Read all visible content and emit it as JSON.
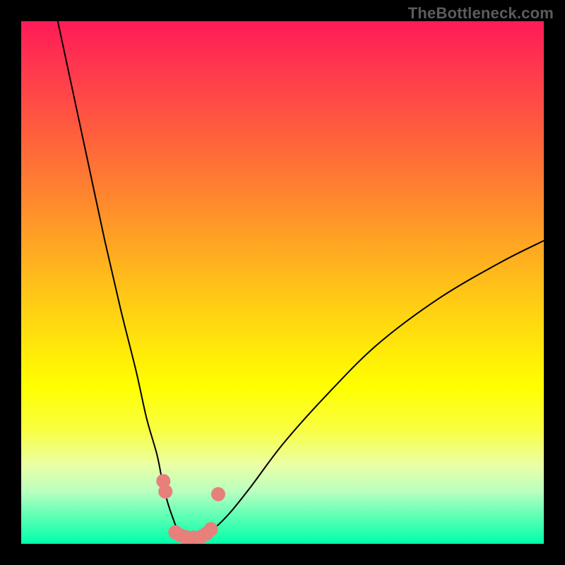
{
  "attribution": "TheBottleneck.com",
  "chart_data": {
    "type": "line",
    "title": "",
    "xlabel": "",
    "ylabel": "",
    "xlim": [
      0,
      100
    ],
    "ylim": [
      0,
      100
    ],
    "series": [
      {
        "name": "bottleneck-curve",
        "x": [
          7,
          10,
          13,
          16,
          19,
          22,
          24,
          26,
          27,
          28,
          29,
          30,
          31,
          32,
          33.5,
          35,
          37,
          40,
          44,
          50,
          58,
          68,
          80,
          92,
          100
        ],
        "values": [
          100,
          86,
          72,
          58,
          45,
          33,
          24,
          17,
          12,
          8,
          5,
          2.5,
          1.5,
          1.2,
          1.2,
          1.7,
          3,
          6,
          11,
          19,
          28,
          38,
          47,
          54,
          58
        ]
      }
    ],
    "markers": {
      "name": "sample-points",
      "color": "#e77f7a",
      "radius": 10,
      "points": [
        {
          "x": 27.2,
          "y": 12
        },
        {
          "x": 27.6,
          "y": 10
        },
        {
          "x": 29.5,
          "y": 2.2
        },
        {
          "x": 30.5,
          "y": 1.6
        },
        {
          "x": 31.5,
          "y": 1.3
        },
        {
          "x": 33.0,
          "y": 1.2
        },
        {
          "x": 34.5,
          "y": 1.4
        },
        {
          "x": 35.5,
          "y": 2.0
        },
        {
          "x": 36.3,
          "y": 2.8
        },
        {
          "x": 37.7,
          "y": 9.5
        }
      ]
    },
    "background_gradient": {
      "stops": [
        {
          "pos": 0,
          "color": "#ff1a58"
        },
        {
          "pos": 50,
          "color": "#ffbf1a"
        },
        {
          "pos": 70,
          "color": "#ffff00"
        },
        {
          "pos": 100,
          "color": "#00ffa9"
        }
      ]
    }
  }
}
